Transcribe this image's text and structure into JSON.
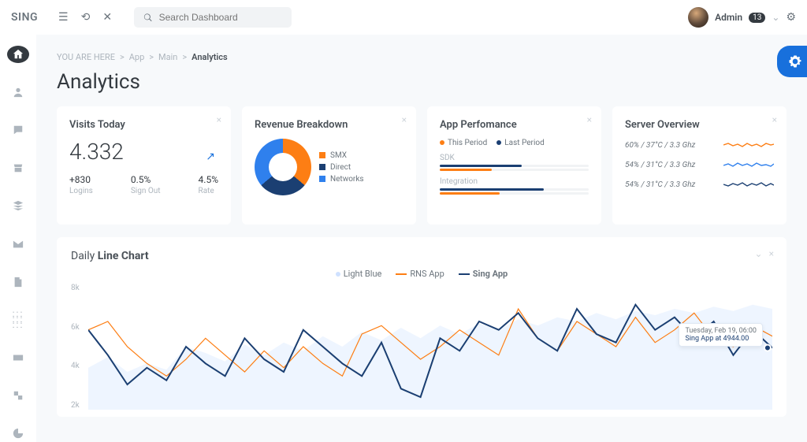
{
  "topbar": {
    "brand": "SING",
    "search_placeholder": "Search Dashboard",
    "user_name": "Admin",
    "user_badge": "13"
  },
  "breadcrumb": {
    "prefix": "YOU ARE HERE",
    "items": [
      "App",
      "Main"
    ],
    "current": "Analytics"
  },
  "page_title": "Analytics",
  "visits": {
    "title": "Visits Today",
    "value": "4.332",
    "stats": [
      {
        "value": "+830",
        "label": "Logins"
      },
      {
        "value": "0.5%",
        "label": "Sign Out"
      },
      {
        "value": "4.5%",
        "label": "Rate"
      }
    ]
  },
  "revenue": {
    "title": "Revenue Breakdown",
    "items": [
      {
        "label": "SMX",
        "color": "#fd7e14"
      },
      {
        "label": "Direct",
        "color": "#1b3f72"
      },
      {
        "label": "Networks",
        "color": "#2f80ed"
      }
    ]
  },
  "perf": {
    "title": "App Perfomance",
    "legend": [
      {
        "label": "This Period",
        "color": "#fd7e14"
      },
      {
        "label": "Last Period",
        "color": "#1b3f72"
      }
    ],
    "bars": [
      {
        "label": "SDK",
        "series": [
          {
            "color": "#1b3f72",
            "pct": 55
          },
          {
            "color": "#fd7e14",
            "pct": 35
          }
        ]
      },
      {
        "label": "Integration",
        "series": [
          {
            "color": "#1b3f72",
            "pct": 70
          },
          {
            "color": "#fd7e14",
            "pct": 40
          }
        ]
      }
    ]
  },
  "server": {
    "title": "Server Overview",
    "rows": [
      {
        "text": "60% / 37°C / 3.3 Ghz",
        "color": "#fd7e14"
      },
      {
        "text": "54% / 31°C / 3.3 Ghz",
        "color": "#2f80ed"
      },
      {
        "text": "54% / 31°C / 3.3 Ghz",
        "color": "#1b3f72"
      }
    ]
  },
  "line": {
    "title_a": "Daily ",
    "title_b": "Line Chart",
    "legend": [
      {
        "label": "Light Blue",
        "color": "#cfe1ff"
      },
      {
        "label": "RNS App",
        "color": "#fd7e14"
      },
      {
        "label": "Sing App",
        "color": "#1b3f72"
      }
    ],
    "y_ticks": [
      "8k",
      "6k",
      "4k",
      "2k"
    ],
    "tooltip": {
      "line1": "Tuesday, Feb 19, 06:00",
      "line2": "Sing App at 4944.00"
    }
  },
  "chart_data": [
    {
      "type": "pie",
      "title": "Revenue Breakdown",
      "series": [
        {
          "name": "SMX",
          "value": 36,
          "color": "#fd7e14"
        },
        {
          "name": "Direct",
          "value": 28,
          "color": "#1b3f72"
        },
        {
          "name": "Networks",
          "value": 36,
          "color": "#2f80ed"
        }
      ]
    },
    {
      "type": "bar",
      "title": "App Perfomance",
      "categories": [
        "SDK",
        "Integration"
      ],
      "series": [
        {
          "name": "Last Period",
          "values": [
            55,
            70
          ],
          "color": "#1b3f72"
        },
        {
          "name": "This Period",
          "values": [
            35,
            40
          ],
          "color": "#fd7e14"
        }
      ],
      "xlabel": "",
      "ylabel": "",
      "ylim": [
        0,
        100
      ]
    },
    {
      "type": "line",
      "title": "Daily Line Chart",
      "ylabel": "",
      "xlabel": "",
      "ylim": [
        2000,
        8000
      ],
      "series": [
        {
          "name": "Light Blue",
          "color": "#cfe1ff",
          "values": [
            4000,
            4500,
            3800,
            4200,
            3900,
            5000,
            4700,
            4300,
            5100,
            4600,
            5200,
            4800,
            5500,
            5000,
            5700,
            5300,
            5900,
            5400,
            6000,
            5600,
            6100,
            5800,
            6300,
            6000,
            6400,
            6200,
            6600,
            6300,
            6700,
            6500,
            6800,
            6600,
            6900,
            6700,
            7000,
            6800
          ]
        },
        {
          "name": "RNS App",
          "color": "#fd7e14",
          "values": [
            5800,
            6200,
            5000,
            4200,
            3600,
            4400,
            5400,
            4600,
            3800,
            4800,
            4000,
            5000,
            4200,
            3600,
            5600,
            6000,
            5200,
            4400,
            5000,
            5800,
            5200,
            4600,
            6800,
            5400,
            4800,
            6200,
            5600,
            5000,
            6400,
            5200,
            5800,
            6600,
            5400,
            5000,
            6000,
            5500
          ]
        },
        {
          "name": "Sing App",
          "color": "#1b3f72",
          "values": [
            5800,
            4600,
            3200,
            4000,
            3400,
            5000,
            4200,
            3600,
            5400,
            4400,
            3800,
            5800,
            5000,
            4200,
            3600,
            5200,
            3000,
            2600,
            5400,
            4800,
            6200,
            5800,
            6600,
            5400,
            4800,
            6800,
            5600,
            5200,
            7000,
            5800,
            6400,
            5400,
            6200,
            4600,
            5800,
            4944
          ]
        }
      ]
    }
  ]
}
